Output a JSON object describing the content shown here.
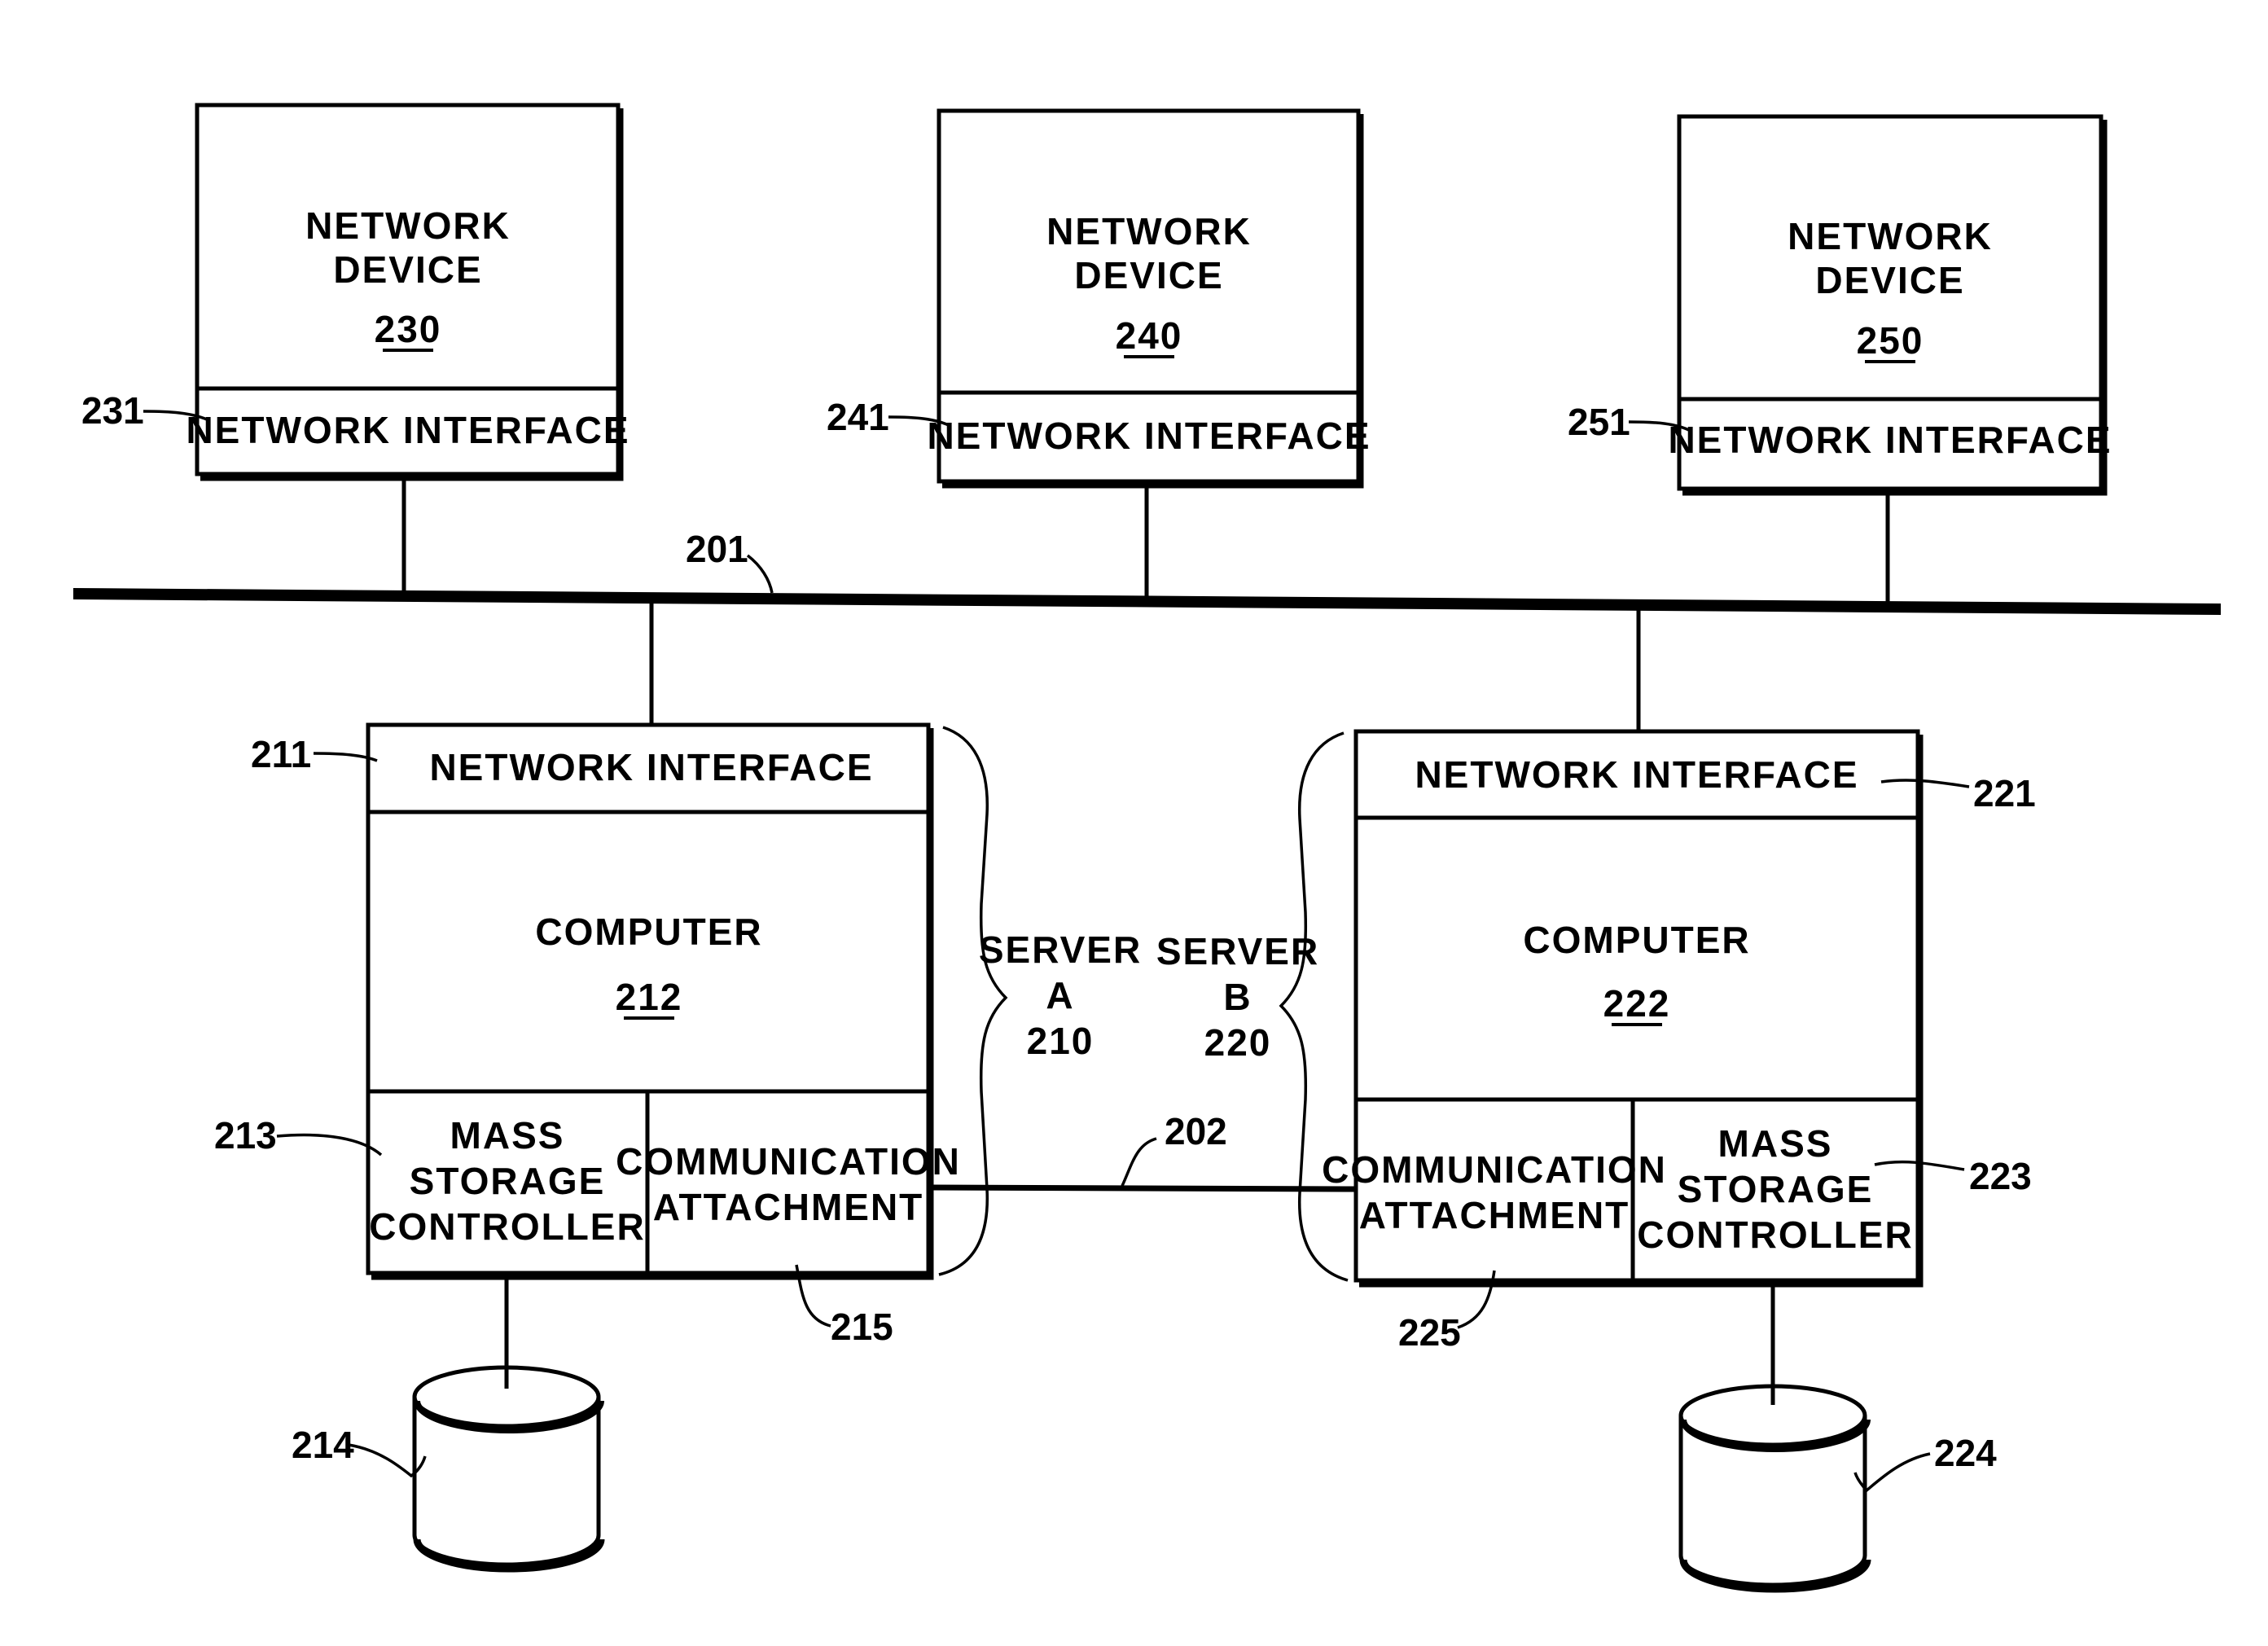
{
  "network_devices": [
    {
      "ref": "230",
      "title_line1": "NETWORK",
      "title_line2": "DEVICE",
      "interface_label": "NETWORK INTERFACE",
      "interface_ref": "231"
    },
    {
      "ref": "240",
      "title_line1": "NETWORK",
      "title_line2": "DEVICE",
      "interface_label": "NETWORK INTERFACE",
      "interface_ref": "241"
    },
    {
      "ref": "250",
      "title_line1": "NETWORK",
      "title_line2": "DEVICE",
      "interface_label": "NETWORK INTERFACE",
      "interface_ref": "251"
    }
  ],
  "network_bus_ref": "201",
  "link_ref": "202",
  "servers": [
    {
      "label_line1": "SERVER",
      "label_line2": "A",
      "ref": "210",
      "interface_label": "NETWORK INTERFACE",
      "interface_ref": "211",
      "computer_label": "COMPUTER",
      "computer_ref": "212",
      "storage_line1": "MASS",
      "storage_line2": "STORAGE",
      "storage_line3": "CONTROLLER",
      "storage_ref": "213",
      "comm_line1": "COMMUNICATION",
      "comm_line2": "ATTACHMENT",
      "comm_ref": "215",
      "disk_ref": "214"
    },
    {
      "label_line1": "SERVER",
      "label_line2": "B",
      "ref": "220",
      "interface_label": "NETWORK INTERFACE",
      "interface_ref": "221",
      "computer_label": "COMPUTER",
      "computer_ref": "222",
      "storage_line1": "MASS",
      "storage_line2": "STORAGE",
      "storage_line3": "CONTROLLER",
      "storage_ref": "223",
      "comm_line1": "COMMUNICATION",
      "comm_line2": "ATTACHMENT",
      "comm_ref": "225",
      "disk_ref": "224"
    }
  ]
}
